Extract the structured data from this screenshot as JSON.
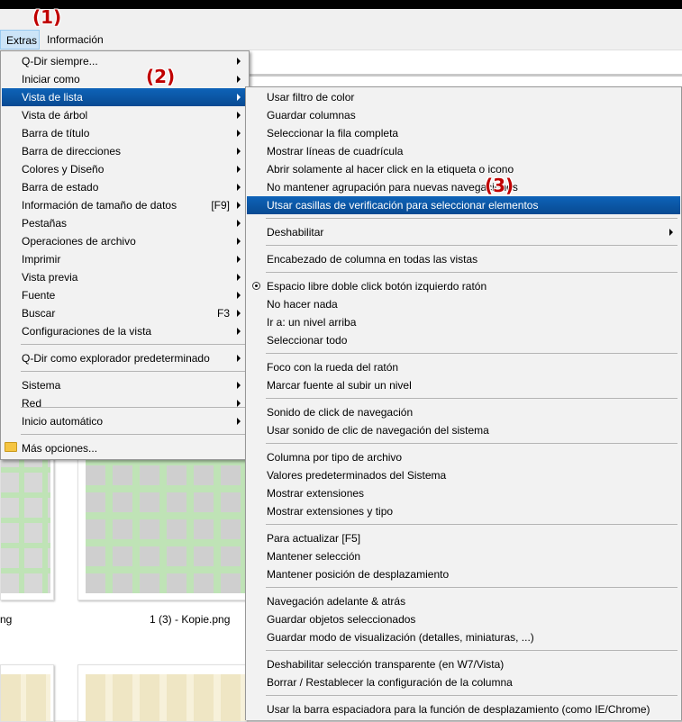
{
  "markers": [
    "(1)",
    "(2)",
    "(3)"
  ],
  "menubar": {
    "items": [
      "Extras",
      "Información"
    ]
  },
  "files": [
    "ng",
    "1 (3) - Kopie.png"
  ],
  "main_menu": {
    "items": [
      {
        "label": "Q-Dir siempre...",
        "submenu": true
      },
      {
        "label": "Iniciar como",
        "submenu": true
      },
      {
        "label": "Vista de lista",
        "submenu": true
      },
      {
        "label": "Vista de árbol",
        "submenu": true
      },
      {
        "label": "Barra de título",
        "submenu": true
      },
      {
        "label": "Barra de direcciones",
        "submenu": true
      },
      {
        "label": "Colores y Diseño",
        "submenu": true
      },
      {
        "label": "Barra de estado",
        "submenu": true
      },
      {
        "label": "Información de tamaño de datos",
        "shortcut": "[F9]",
        "submenu": true
      },
      {
        "label": "Pestañas",
        "submenu": true
      },
      {
        "label": "Operaciones de archivo",
        "submenu": true
      },
      {
        "label": "Imprimir",
        "submenu": true
      },
      {
        "label": "Vista previa",
        "submenu": true
      },
      {
        "label": "Fuente",
        "submenu": true
      },
      {
        "label": "Buscar",
        "shortcut": "F3",
        "submenu": true
      },
      {
        "label": "Configuraciones de la vista",
        "submenu": true
      },
      {
        "label": "Q-Dir como explorador predeterminado",
        "submenu": true
      },
      {
        "label": "Sistema",
        "submenu": true
      },
      {
        "label": "Red",
        "submenu": true
      },
      {
        "label": "Inicio automático",
        "submenu": true
      },
      {
        "label": "Más opciones...",
        "submenu": false
      }
    ]
  },
  "sub_menu": {
    "items": [
      "Usar filtro de color",
      "Guardar columnas",
      "Seleccionar la fila completa",
      "Mostrar líneas de cuadrícula",
      "Abrir solamente al hacer click en la etiqueta o icono",
      "No mantener agrupación para nuevas navegaciones",
      "Utsar casillas de verificación para seleccionar elementos",
      "Deshabilitar",
      "Encabezado de columna en todas las vistas",
      "Espacio libre doble click botón izquierdo ratón",
      "No hacer nada",
      "Ir a: un nivel arriba",
      "Seleccionar todo",
      "Foco con la rueda del ratón",
      "Marcar fuente al subir un nivel",
      "Sonido de click de navegación",
      "Usar sonido de clic de navegación del sistema",
      "Columna por tipo de archivo",
      "Valores predeterminados del Sistema",
      "Mostrar extensiones",
      "Mostrar extensiones y tipo",
      "Para actualizar [F5]",
      "Mantener selección",
      "Mantener posición de desplazamiento",
      "Navegación adelante & atrás",
      "Guardar objetos seleccionados",
      "Guardar modo de visualización (detalles, miniaturas, ...)",
      "Deshabilitar selección transparente (en W7/Vista)",
      "Borrar / Restablecer la configuración de la columna",
      "Usar la barra espaciadora para la función de desplazamiento (como IE/Chrome)"
    ]
  }
}
